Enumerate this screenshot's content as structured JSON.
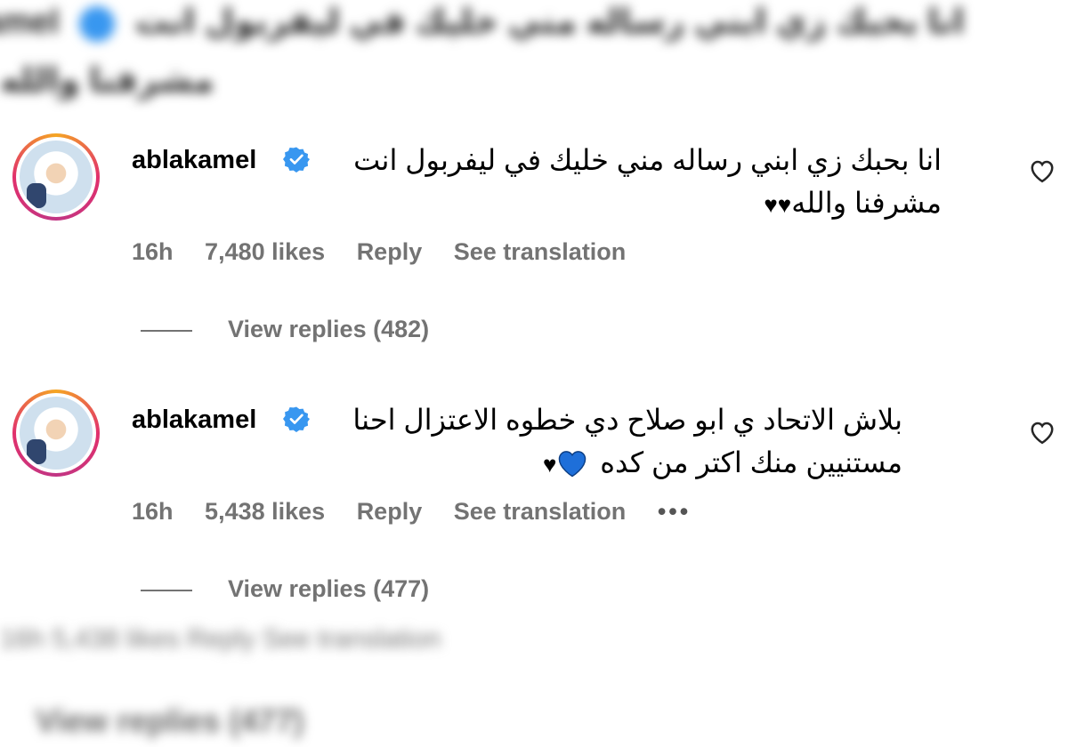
{
  "background": {
    "top_line1_a": "amel",
    "top_line1_b": "انا بحبك زي ابني رساله مني خليك في ليفربول انت",
    "top_line2": "مشرفنا والله",
    "bottom_row": "16h    5,438 likes    Reply    See translation",
    "bottom_view": "View replies (477)"
  },
  "colors": {
    "verified": "#3897f0",
    "meta": "#737373",
    "ring_gradient": [
      "#f5a623",
      "#e1306c",
      "#c13584"
    ],
    "blue_heart": "#1e6fd9"
  },
  "comments": [
    {
      "username": "ablakamel",
      "text_line1": "انا بحبك زي ابني رساله مني خليك في ليفربول انت",
      "text_line2": "مشرفنا والله",
      "hearts": "♥♥",
      "time": "16h",
      "likes": "7,480 likes",
      "reply": "Reply",
      "see_translation": "See translation",
      "more": "",
      "view_replies": "View replies (482)"
    },
    {
      "username": "ablakamel",
      "text_line1": "بلاش الاتحاد ي ابو صلاح دي خطوه الاعتزال احنا",
      "text_line2": "مستنيين منك اكتر من كده",
      "hearts": "♥",
      "time": "16h",
      "likes": "5,438 likes",
      "reply": "Reply",
      "see_translation": "See translation",
      "more": "•••",
      "view_replies": "View replies (477)"
    }
  ],
  "icons": {
    "verified": "verified-badge-icon",
    "like": "heart-outline-icon",
    "blue_heart": "blue-heart-icon",
    "more": "more-horizontal-icon"
  }
}
